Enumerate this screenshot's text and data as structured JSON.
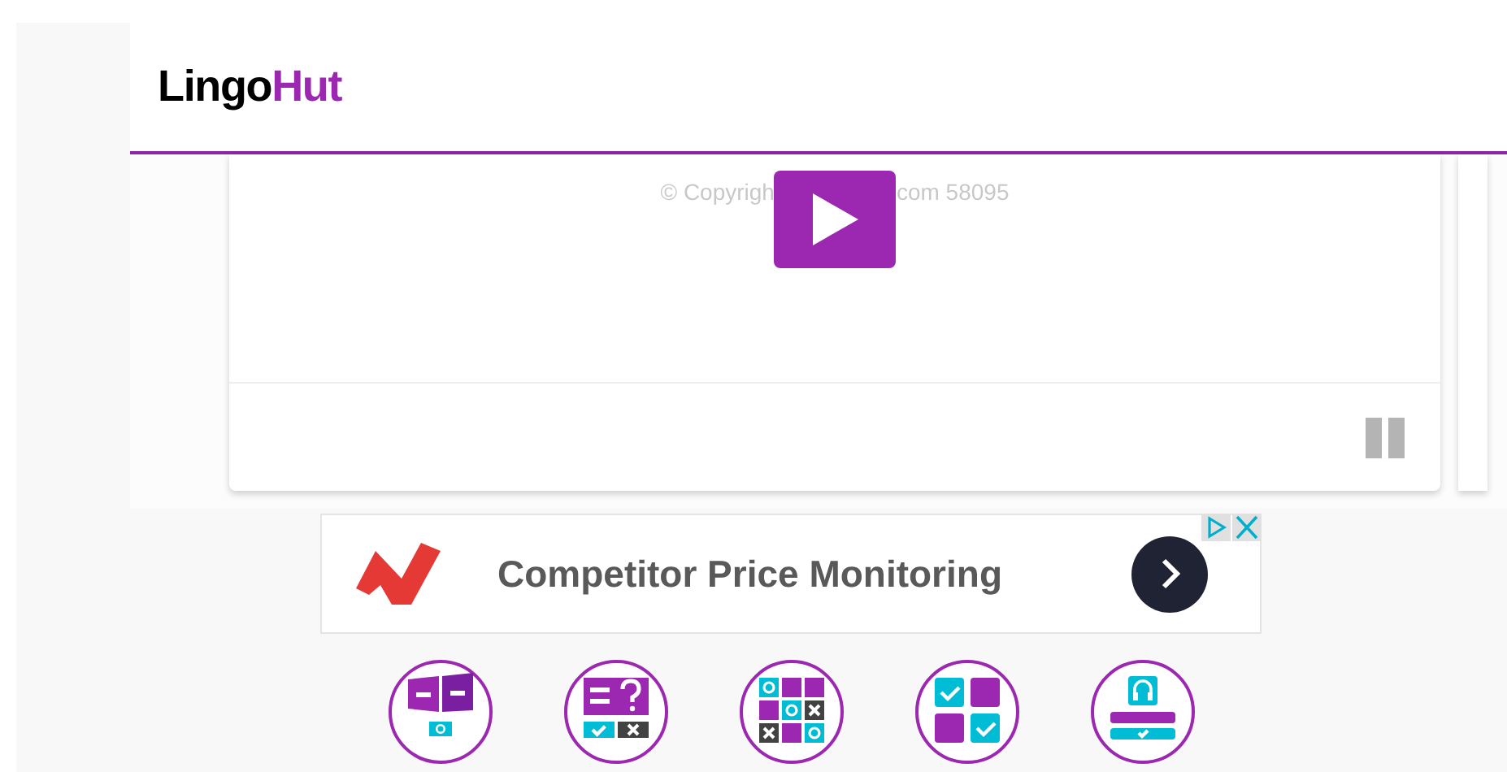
{
  "header": {
    "logo": [
      "Lingo",
      "Hut"
    ]
  },
  "player": {
    "copyright_left": "© Copyrigh",
    "copyright_right": "com 58095"
  },
  "ad": {
    "headline": "Competitor Price Monitoring"
  },
  "activities": [
    {
      "kind": "flashcards"
    },
    {
      "kind": "quiz"
    },
    {
      "kind": "tictactoe"
    },
    {
      "kind": "matching"
    },
    {
      "kind": "listening"
    }
  ]
}
